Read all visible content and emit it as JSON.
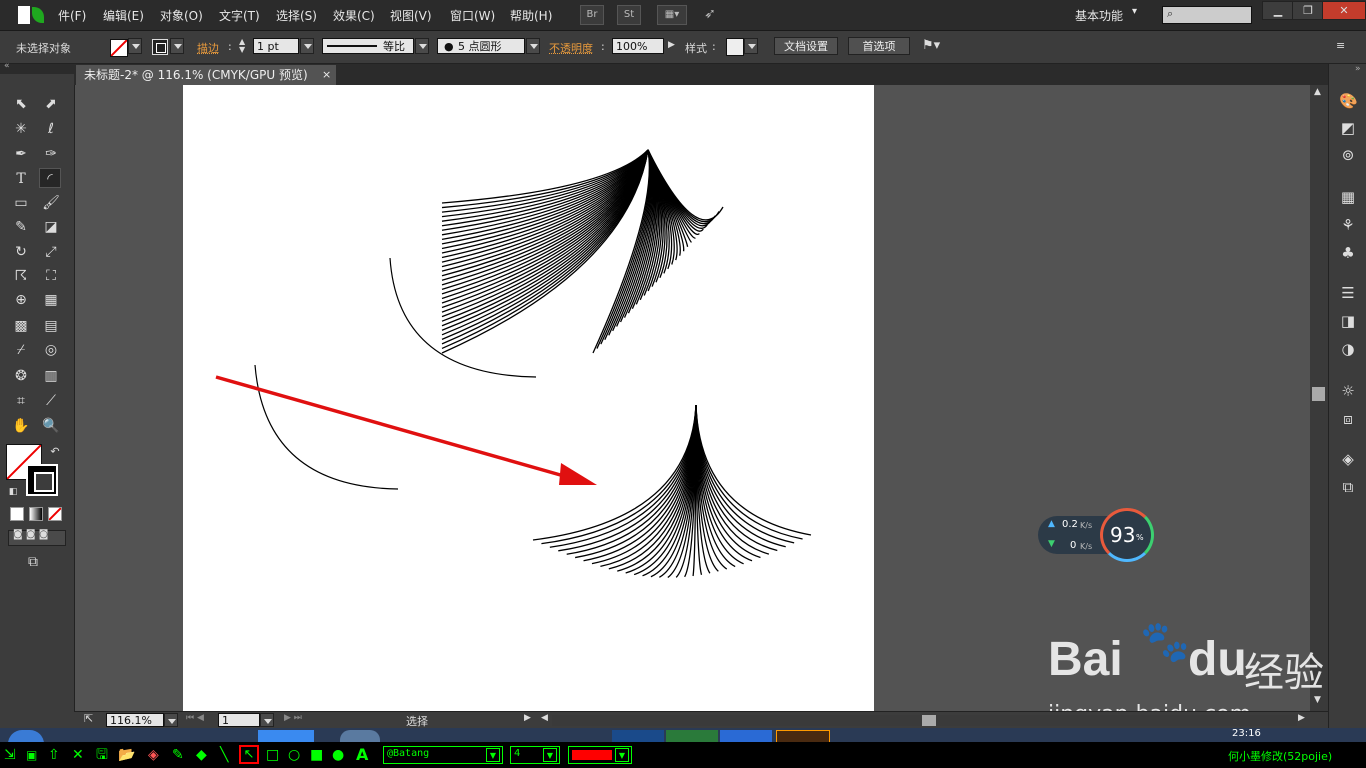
{
  "menubar": {
    "items": [
      "件(F)",
      "编辑(E)",
      "对象(O)",
      "文字(T)",
      "选择(S)",
      "效果(C)",
      "视图(V)",
      "窗口(W)",
      "帮助(H)"
    ],
    "bridge_label": "Br",
    "stock_label": "St",
    "workspace": "基本功能",
    "search_placeholder": ""
  },
  "control": {
    "selection_status": "未选择对象",
    "stroke_label": "描边",
    "stroke_weight": "1 pt",
    "profile_label": "等比",
    "brush_label": "5 点圆形",
    "opacity_label": "不透明度",
    "opacity_value": "100%",
    "style_label": "样式",
    "doc_setup": "文档设置",
    "preferences": "首选项"
  },
  "document": {
    "tab_title": "未标题-2* @ 116.1% (CMYK/GPU 预览)",
    "close": "×"
  },
  "status": {
    "zoom": "116.1%",
    "page": "1",
    "tool_name": "选择"
  },
  "netwidget": {
    "upload": "0.2",
    "download": "0",
    "unit": "K/s",
    "percent": "93",
    "percent_sign": "%"
  },
  "drawbar": {
    "font_name": "@Batang",
    "size": "4",
    "color": "#ff0000",
    "credit": "何小墨修改(52pojie)"
  },
  "watermark": {
    "brand": "Bai",
    "brand2": "du",
    "suffix": "经验",
    "url": "jingyan.baidu.com"
  },
  "taskbar": {
    "clock": "23:16"
  },
  "colors": {
    "accent_orange": "#e89a3c",
    "arrow_red": "#e01010",
    "draw_green": "#00ff00"
  }
}
